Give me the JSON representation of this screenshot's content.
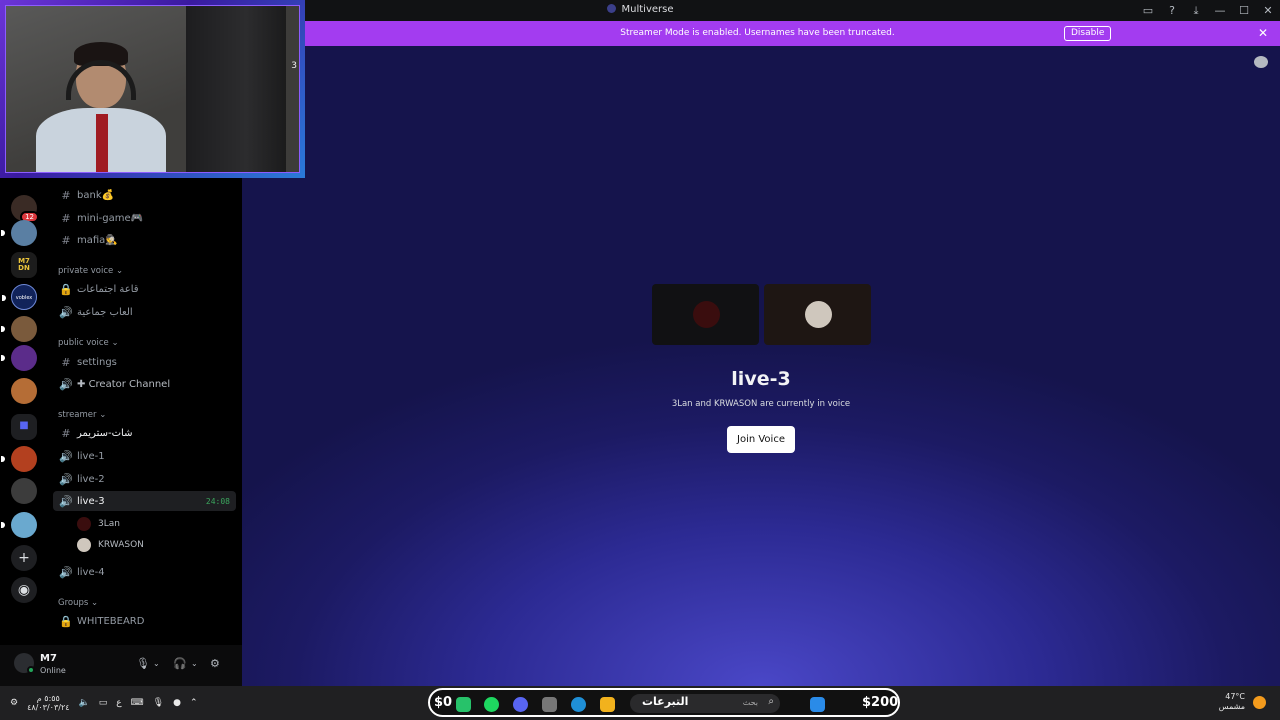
{
  "titlebar": {
    "title": "Multiverse"
  },
  "banner": {
    "message": "Streamer Mode is enabled. Usernames have been truncated.",
    "disable_label": "Disable",
    "close": "✕"
  },
  "webcam": {
    "overlay_number": "3"
  },
  "servers": [
    {
      "badge": "12"
    },
    {
      "label": ""
    },
    {
      "label": "M7\nDN"
    },
    {
      "label": "voblex"
    },
    {
      "label": ""
    },
    {
      "label": ""
    },
    {
      "label": ""
    },
    {
      "label": ""
    },
    {
      "label": ""
    },
    {
      "label": ""
    },
    {
      "label": ""
    }
  ],
  "channels": {
    "text_top": [
      {
        "name": "bank💰"
      },
      {
        "name": "mini-game🎮"
      },
      {
        "name": "mafia🕵️"
      }
    ],
    "private_voice": {
      "label": "private voice",
      "items": [
        {
          "name": "قاعة اجتماعات"
        },
        {
          "name": "العاب جماعية"
        }
      ]
    },
    "public_voice": {
      "label": "public voice",
      "items": [
        {
          "name": "settings"
        },
        {
          "name": "Creator Channel"
        }
      ]
    },
    "streamer": {
      "label": "streamer",
      "items": [
        {
          "name": "شات-ستريمر"
        },
        {
          "name": "live-1"
        },
        {
          "name": "live-2"
        },
        {
          "name": "live-3",
          "timer": "24:08"
        },
        {
          "name": "live-4"
        }
      ],
      "voice_users": [
        {
          "name": "3Lan"
        },
        {
          "name": "KRWASON"
        }
      ]
    },
    "groups": {
      "label": "Groups",
      "items": [
        {
          "name": "WHITEBEARD"
        }
      ]
    }
  },
  "user": {
    "name": "M7",
    "status": "Online"
  },
  "main": {
    "channel_name": "live-3",
    "description": "3Lan and KRWASON are currently in voice",
    "join_label": "Join Voice"
  },
  "taskbar": {
    "clock_time": "٥:٥٥ م",
    "clock_date": "٤٨/٠٣/٠٣/٢٤",
    "lang": "ع",
    "money_left": "$0",
    "money_right": "$200",
    "search_label": "التبرعات",
    "search_placeholder": "بحث",
    "temp": "47°C",
    "weather": "مشمس"
  },
  "colors": {
    "accent": "#a33cf0",
    "online": "#23a55a",
    "join": "#ffffff"
  }
}
